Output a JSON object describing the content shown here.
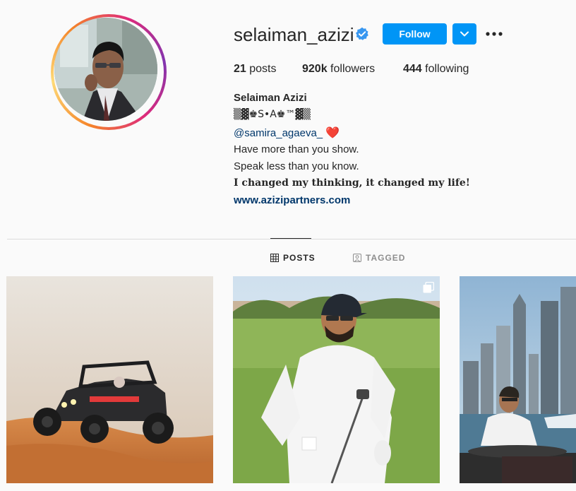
{
  "profile": {
    "username": "selaiman_azizi",
    "verified": true,
    "follow_label": "Follow",
    "posts_count": "21",
    "posts_label": "posts",
    "followers_count": "920k",
    "followers_label": "followers",
    "following_count": "444",
    "following_label": "following"
  },
  "bio": {
    "name": "Selaiman Azizi",
    "decor_line": "▒▓♚S•A♚™▓▒",
    "mention": "@samira_agaeva_",
    "heart": "❤️",
    "line1": "Have more than you show.",
    "line2": "Speak less than you know.",
    "line3": "I changed my thinking, it changed my life!",
    "website": "www.azizipartners.com"
  },
  "tabs": {
    "posts": "POSTS",
    "tagged": "TAGGED"
  },
  "colors": {
    "accent": "#0095f6",
    "link": "#00376b",
    "text": "#262626",
    "muted": "#8e8e8e",
    "heart": "#ed4956"
  },
  "icons": {
    "verified": "verified-badge-icon",
    "dropdown": "chevron-down-icon",
    "more": "more-options-icon",
    "posts_tab": "grid-icon",
    "tagged_tab": "tagged-user-icon",
    "multi": "multiple-posts-icon"
  }
}
